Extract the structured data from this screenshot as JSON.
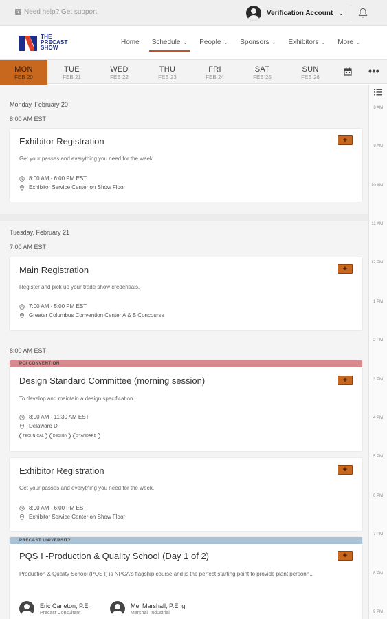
{
  "topbar": {
    "help_text": "Need help? Get support",
    "account_name": "Verification Account"
  },
  "nav": {
    "logo_lines": [
      "THE",
      "PRECAST",
      "SHOW"
    ],
    "items": [
      {
        "label": "Home",
        "has_caret": false
      },
      {
        "label": "Schedule",
        "has_caret": true,
        "active": true
      },
      {
        "label": "People",
        "has_caret": true
      },
      {
        "label": "Sponsors",
        "has_caret": true
      },
      {
        "label": "Exhibitors",
        "has_caret": true
      },
      {
        "label": "More",
        "has_caret": true
      }
    ]
  },
  "days": [
    {
      "name": "MON",
      "date": "FEB 20",
      "active": true
    },
    {
      "name": "TUE",
      "date": "FEB 21"
    },
    {
      "name": "WED",
      "date": "FEB 22"
    },
    {
      "name": "THU",
      "date": "FEB 23"
    },
    {
      "name": "FRI",
      "date": "FEB 24"
    },
    {
      "name": "SAT",
      "date": "FEB 25"
    },
    {
      "name": "SUN",
      "date": "FEB 26"
    }
  ],
  "more_label": "•••",
  "schedule": {
    "day1": {
      "date": "Monday, February 20",
      "time": "8:00 AM EST",
      "sessions": [
        {
          "title": "Exhibitor Registration",
          "description": "Get your passes and everything you need for the week.",
          "time": "8:00 AM - 6:00 PM EST",
          "location": "Exhibitor Service Center on Show Floor"
        }
      ]
    },
    "day2": {
      "date": "Tuesday, February 21",
      "time": "7:00 AM EST",
      "sessions": [
        {
          "title": "Main Registration",
          "description": "Register and pick up your trade show credentials.",
          "time": "7:00 AM - 5:00 PM EST",
          "location": "Greater Columbus Convention Center A & B Concourse"
        }
      ]
    },
    "slot2": {
      "time": "8:00 AM EST",
      "sessions": [
        {
          "tag": "PCI CONVENTION",
          "tag_color": "#d98a8f",
          "title": "Design Standard Committee (morning session)",
          "description": "To develop and maintain a design specification.",
          "time": "8:00 AM - 11:30 AM EST",
          "location": "Delaware D",
          "pills": [
            "TECHNICAL",
            "DESIGN",
            "STANDARD"
          ]
        },
        {
          "title": "Exhibitor Registration",
          "description": "Get your passes and everything you need for the week.",
          "time": "8:00 AM - 6:00 PM EST",
          "location": "Exhibitor Service Center on Show Floor"
        },
        {
          "tag": "PRECAST UNIVERSITY",
          "tag_color": "#a9c2d6",
          "title": "PQS I -Production & Quality School (Day 1 of 2)",
          "description": "Production & Quality School (PQS I) is NPCA's flagship course and is the perfect starting point to provide plant personn...",
          "speakers": [
            {
              "name": "Eric Carleton, P.E.",
              "org": "Precast Consultant"
            },
            {
              "name": "Mel Marshall, P.Eng.",
              "org": "Marshall Industrial"
            }
          ]
        }
      ]
    }
  },
  "add_label": "+",
  "timeline": [
    "8 AM",
    "9 AM",
    "10 AM",
    "11 AM",
    "12 PM",
    "1 PM",
    "2 PM",
    "3 PM",
    "4 PM",
    "5 PM",
    "6 PM",
    "7 PM",
    "8 PM",
    "9 PM"
  ],
  "colors": {
    "accent": "#c7681e",
    "logo_blue": "#1b2e8c",
    "logo_red": "#e0402a"
  }
}
